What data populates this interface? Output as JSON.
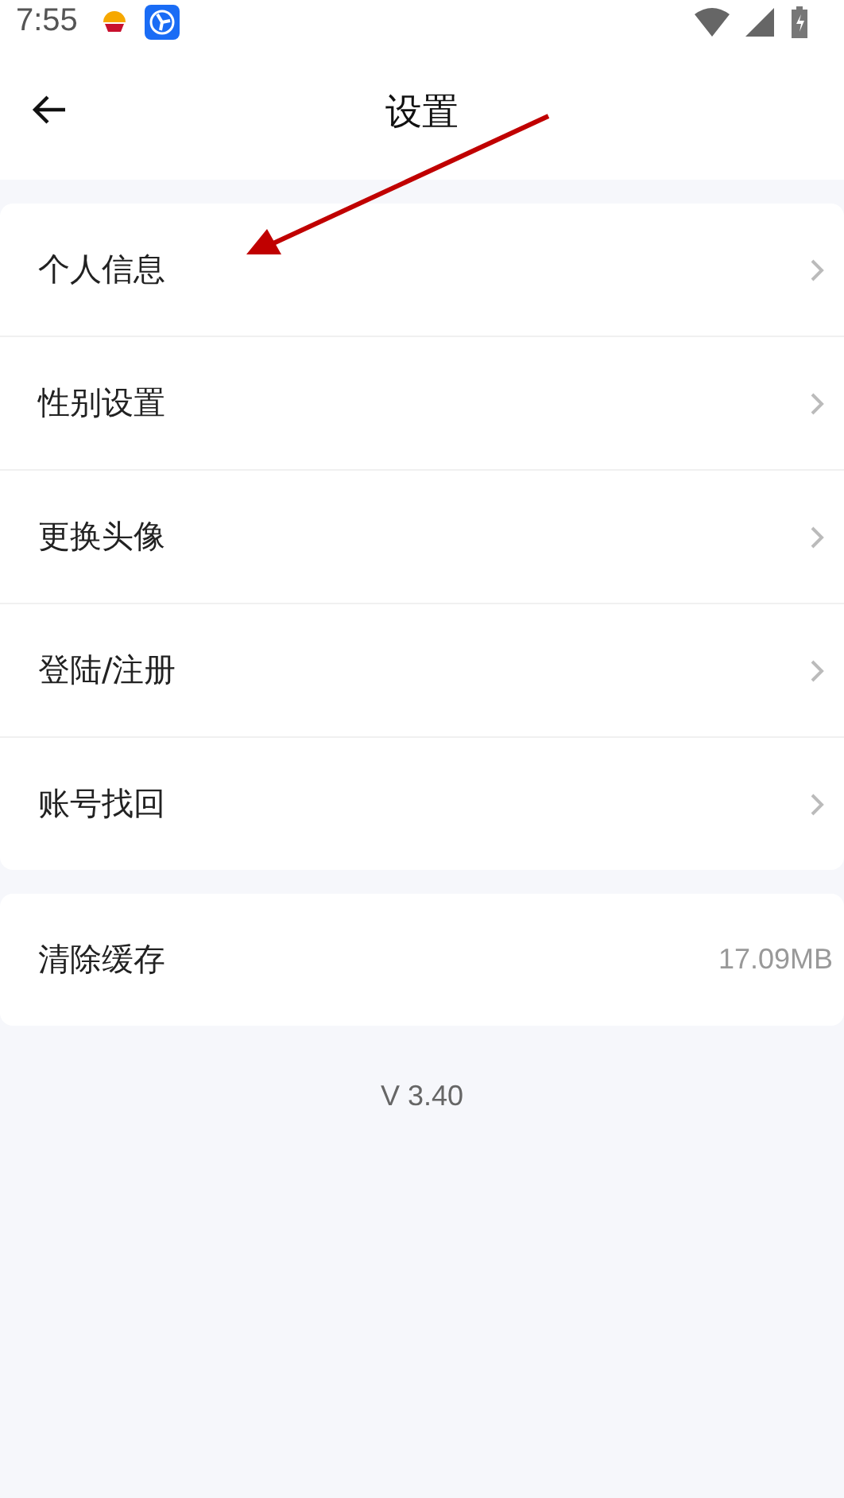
{
  "status_bar": {
    "time": "7:55"
  },
  "header": {
    "title": "设置"
  },
  "menu_items": [
    {
      "label": "个人信息"
    },
    {
      "label": "性别设置"
    },
    {
      "label": "更换头像"
    },
    {
      "label": "登陆/注册"
    },
    {
      "label": "账号找回"
    }
  ],
  "cache": {
    "label": "清除缓存",
    "value": "17.09MB"
  },
  "version": "V 3.40"
}
